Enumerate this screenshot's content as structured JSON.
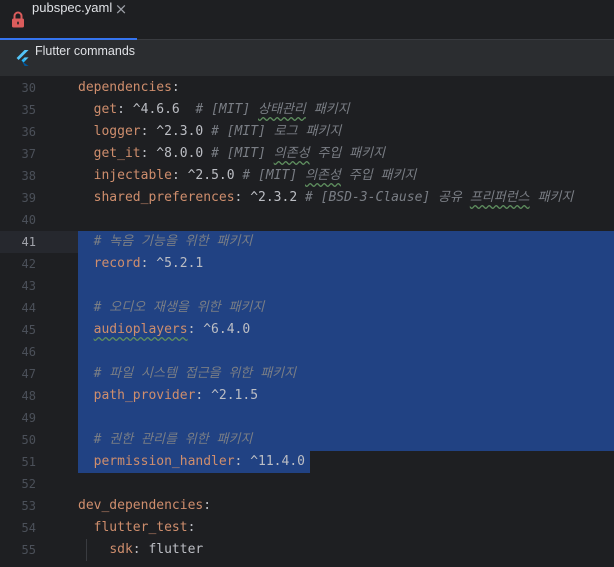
{
  "tab": {
    "title": "pubspec.yaml",
    "icon": "lock-icon",
    "close_icon": "close-icon",
    "close_label": "×"
  },
  "toolbar": {
    "icon": "flutter-icon",
    "label": "Flutter commands"
  },
  "colors": {
    "editor_bg": "#1e1f22",
    "tabbar_bg": "#1e1f22",
    "toolbar_bg": "#2b2d30",
    "accent": "#3574f0",
    "lock": "#db5c5c",
    "key": "#cf8e6d",
    "value": "#bcbec4",
    "comment": "#7a7e85",
    "selection": "#214283",
    "line_number": "#4b5059",
    "line_number_current": "#a1a3ab",
    "typo": "#5f8f5f"
  },
  "editor": {
    "lines": [
      {
        "number": "30",
        "indent": "",
        "key": "dependencies",
        "colon": ":"
      },
      {
        "number": "35",
        "indent": "  ",
        "key": "get",
        "colon": ": ",
        "value": "^4.6.6",
        "gap": "  ",
        "comment": [
          {
            "text": "# [MIT] "
          },
          {
            "text": "상태관리",
            "typo": true
          },
          {
            "text": " 패키지"
          }
        ]
      },
      {
        "number": "36",
        "indent": "  ",
        "key": "logger",
        "colon": ": ",
        "value": "^2.3.0",
        "gap": " ",
        "comment": [
          {
            "text": "# [MIT] 로그 패키지"
          }
        ]
      },
      {
        "number": "37",
        "indent": "  ",
        "key": "get_it",
        "colon": ": ",
        "value": "^8.0.0",
        "gap": " ",
        "comment": [
          {
            "text": "# [MIT] "
          },
          {
            "text": "의존성",
            "typo": true
          },
          {
            "text": " 주입 패키지"
          }
        ]
      },
      {
        "number": "38",
        "indent": "  ",
        "key": "injectable",
        "colon": ": ",
        "value": "^2.5.0",
        "gap": " ",
        "comment": [
          {
            "text": "# [MIT] "
          },
          {
            "text": "의존성",
            "typo": true
          },
          {
            "text": " 주입 패키지"
          }
        ]
      },
      {
        "number": "39",
        "indent": "  ",
        "key": "shared_preferences",
        "colon": ": ",
        "value": "^2.3.2",
        "gap": " ",
        "comment": [
          {
            "text": "# [BSD-3-Clause] 공유 "
          },
          {
            "text": "프리퍼런스",
            "typo": true
          },
          {
            "text": " 패키지"
          }
        ]
      },
      {
        "number": "40"
      },
      {
        "number": "41",
        "current": true,
        "selected": true,
        "selected_to_edge": true,
        "indent": "  ",
        "comment": [
          {
            "text": "# 녹음 기능을 위한 패키지"
          }
        ]
      },
      {
        "number": "42",
        "selected": true,
        "selected_to_edge": true,
        "indent": "  ",
        "key": "record",
        "colon": ": ",
        "value": "^5.2.1"
      },
      {
        "number": "43",
        "selected": true,
        "selected_to_edge": true
      },
      {
        "number": "44",
        "selected": true,
        "selected_to_edge": true,
        "indent": "  ",
        "comment": [
          {
            "text": "# 오디오 재생을 위한 패키지"
          }
        ]
      },
      {
        "number": "45",
        "selected": true,
        "selected_to_edge": true,
        "indent": "  ",
        "key": "audioplayers",
        "key_typo": true,
        "colon": ": ",
        "value": "^6.4.0"
      },
      {
        "number": "46",
        "selected": true,
        "selected_to_edge": true
      },
      {
        "number": "47",
        "selected": true,
        "selected_to_edge": true,
        "indent": "  ",
        "comment": [
          {
            "text": "# 파일 시스템 접근을 위한 패키지"
          }
        ]
      },
      {
        "number": "48",
        "selected": true,
        "selected_to_edge": true,
        "indent": "  ",
        "key": "path_provider",
        "colon": ": ",
        "value": "^2.1.5"
      },
      {
        "number": "49",
        "selected": true,
        "selected_to_edge": true
      },
      {
        "number": "50",
        "selected": true,
        "selected_to_edge": true,
        "indent": "  ",
        "comment": [
          {
            "text": "# 권한 관리를 위한 패키지"
          }
        ]
      },
      {
        "number": "51",
        "selected": true,
        "selected_to_edge": false,
        "indent": "  ",
        "key": "permission_handler",
        "colon": ": ",
        "value": "^11.4.0"
      },
      {
        "number": "52"
      },
      {
        "number": "53",
        "indent": "",
        "key": "dev_dependencies",
        "colon": ":"
      },
      {
        "number": "54",
        "indent": "  ",
        "key": "flutter_test",
        "colon": ":"
      },
      {
        "number": "55",
        "indent": "    ",
        "key": "sdk",
        "colon": ": ",
        "value": "flutter",
        "indent_guide": true
      }
    ]
  }
}
